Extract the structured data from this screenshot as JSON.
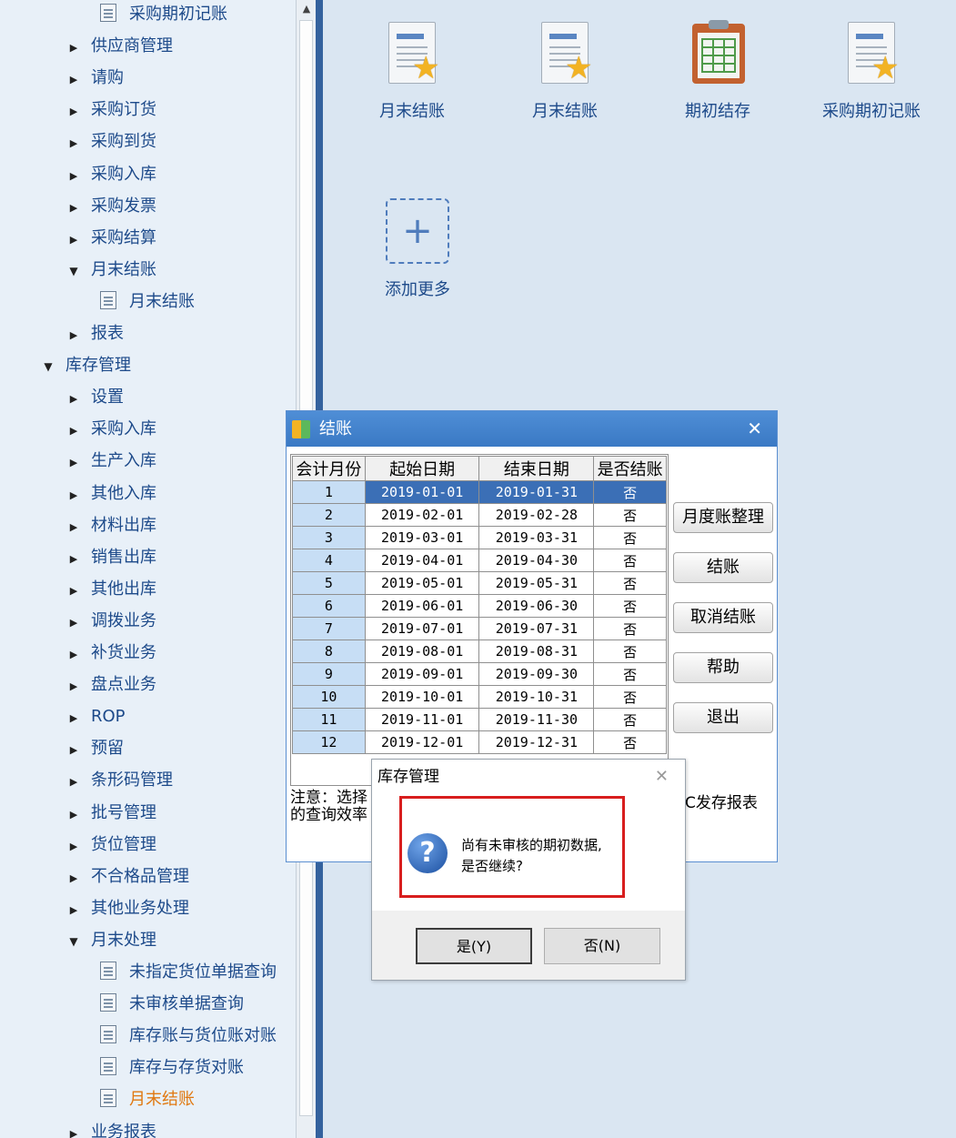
{
  "tree": [
    {
      "label": "采购期初记账",
      "level": 2,
      "kind": "doc"
    },
    {
      "label": "供应商管理",
      "level": 1,
      "kind": "collapsed"
    },
    {
      "label": "请购",
      "level": 1,
      "kind": "collapsed"
    },
    {
      "label": "采购订货",
      "level": 1,
      "kind": "collapsed"
    },
    {
      "label": "采购到货",
      "level": 1,
      "kind": "collapsed"
    },
    {
      "label": "采购入库",
      "level": 1,
      "kind": "collapsed"
    },
    {
      "label": "采购发票",
      "level": 1,
      "kind": "collapsed"
    },
    {
      "label": "采购结算",
      "level": 1,
      "kind": "collapsed"
    },
    {
      "label": "月末结账",
      "level": 1,
      "kind": "expanded"
    },
    {
      "label": "月末结账",
      "level": 2,
      "kind": "doc"
    },
    {
      "label": "报表",
      "level": 1,
      "kind": "collapsed"
    },
    {
      "label": "库存管理",
      "level": 0,
      "kind": "expanded"
    },
    {
      "label": "设置",
      "level": 1,
      "kind": "collapsed"
    },
    {
      "label": "采购入库",
      "level": 1,
      "kind": "collapsed"
    },
    {
      "label": "生产入库",
      "level": 1,
      "kind": "collapsed"
    },
    {
      "label": "其他入库",
      "level": 1,
      "kind": "collapsed"
    },
    {
      "label": "材料出库",
      "level": 1,
      "kind": "collapsed"
    },
    {
      "label": "销售出库",
      "level": 1,
      "kind": "collapsed"
    },
    {
      "label": "其他出库",
      "level": 1,
      "kind": "collapsed"
    },
    {
      "label": "调拨业务",
      "level": 1,
      "kind": "collapsed"
    },
    {
      "label": "补货业务",
      "level": 1,
      "kind": "collapsed"
    },
    {
      "label": "盘点业务",
      "level": 1,
      "kind": "collapsed"
    },
    {
      "label": "ROP",
      "level": 1,
      "kind": "collapsed"
    },
    {
      "label": "预留",
      "level": 1,
      "kind": "collapsed"
    },
    {
      "label": "条形码管理",
      "level": 1,
      "kind": "collapsed"
    },
    {
      "label": "批号管理",
      "level": 1,
      "kind": "collapsed"
    },
    {
      "label": "货位管理",
      "level": 1,
      "kind": "collapsed"
    },
    {
      "label": "不合格品管理",
      "level": 1,
      "kind": "collapsed"
    },
    {
      "label": "其他业务处理",
      "level": 1,
      "kind": "collapsed"
    },
    {
      "label": "月末处理",
      "level": 1,
      "kind": "expanded"
    },
    {
      "label": "未指定货位单据查询",
      "level": 2,
      "kind": "doc"
    },
    {
      "label": "未审核单据查询",
      "level": 2,
      "kind": "doc"
    },
    {
      "label": "库存账与货位账对账",
      "level": 2,
      "kind": "doc"
    },
    {
      "label": "库存与存货对账",
      "level": 2,
      "kind": "doc"
    },
    {
      "label": "月末结账",
      "level": 2,
      "kind": "doc",
      "active": true
    },
    {
      "label": "业务报表",
      "level": 1,
      "kind": "collapsed"
    }
  ],
  "desktop": {
    "tiles": [
      {
        "label": "月末结账",
        "icon": "document-star-icon"
      },
      {
        "label": "月末结账",
        "icon": "document-star-icon"
      },
      {
        "label": "期初结存",
        "icon": "clipboard-grid-icon"
      },
      {
        "label": "采购期初记账",
        "icon": "document-star-icon"
      }
    ],
    "add_more": "添加更多"
  },
  "settle_window": {
    "title": "结账",
    "columns": [
      "会计月份",
      "起始日期",
      "结束日期",
      "是否结账"
    ],
    "rows": [
      [
        "1",
        "2019-01-01",
        "2019-01-31",
        "否"
      ],
      [
        "2",
        "2019-02-01",
        "2019-02-28",
        "否"
      ],
      [
        "3",
        "2019-03-01",
        "2019-03-31",
        "否"
      ],
      [
        "4",
        "2019-04-01",
        "2019-04-30",
        "否"
      ],
      [
        "5",
        "2019-05-01",
        "2019-05-31",
        "否"
      ],
      [
        "6",
        "2019-06-01",
        "2019-06-30",
        "否"
      ],
      [
        "7",
        "2019-07-01",
        "2019-07-31",
        "否"
      ],
      [
        "8",
        "2019-08-01",
        "2019-08-31",
        "否"
      ],
      [
        "9",
        "2019-09-01",
        "2019-09-30",
        "否"
      ],
      [
        "10",
        "2019-10-01",
        "2019-10-31",
        "否"
      ],
      [
        "11",
        "2019-11-01",
        "2019-11-30",
        "否"
      ],
      [
        "12",
        "2019-12-01",
        "2019-12-31",
        "否"
      ]
    ],
    "buttons": [
      "月度账整理",
      "结账",
      "取消结账",
      "帮助",
      "退出"
    ],
    "note_line1": "注意：选择",
    "note_line2": "的查询效率",
    "note_right": "C发存报表"
  },
  "msgbox": {
    "title": "库存管理",
    "line1": "尚有未审核的期初数据,",
    "line2": "是否继续?",
    "yes": "是(Y)",
    "no": "否(N)"
  },
  "colors": {
    "accent": "#3b6fb6",
    "highlight_box": "#d81e1e",
    "active_tree_item": "#e07810"
  }
}
